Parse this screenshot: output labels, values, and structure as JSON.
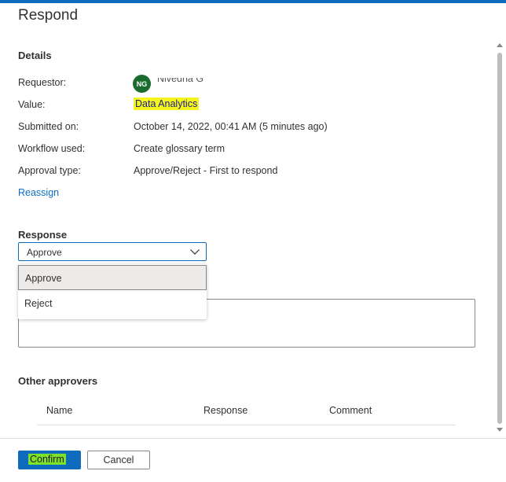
{
  "panel": {
    "title": "Respond"
  },
  "details": {
    "heading": "Details",
    "requestor_label": "Requestor:",
    "requestor_initials": "NG",
    "requestor_name": "Nivedha G",
    "value_label": "Value:",
    "value": "Data Analytics",
    "submitted_label": "Submitted on:",
    "submitted": "October 14, 2022, 00:41 AM (5 minutes ago)",
    "workflow_label": "Workflow used:",
    "workflow": "Create glossary term",
    "approval_label": "Approval type:",
    "approval": "Approve/Reject - First to respond",
    "reassign": "Reassign"
  },
  "response": {
    "heading": "Response",
    "selected": "Approve",
    "options": [
      "Approve",
      "Reject"
    ]
  },
  "other_approvers": {
    "heading": "Other approvers",
    "columns": [
      "Name",
      "Response",
      "Comment"
    ]
  },
  "footer": {
    "confirm": "Confirm",
    "cancel": "Cancel"
  },
  "colors": {
    "accent": "#0f6cbd",
    "avatar": "#1b6b2f",
    "highlight": "#f4f41e"
  }
}
